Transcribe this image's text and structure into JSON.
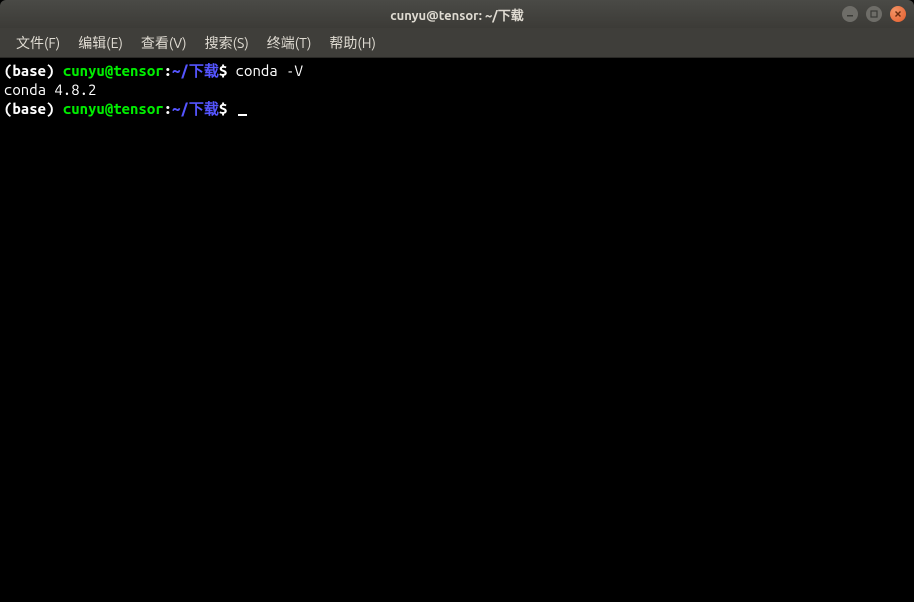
{
  "window": {
    "title": "cunyu@tensor: ~/下载"
  },
  "menu": {
    "items": [
      "文件(F)",
      "编辑(E)",
      "查看(V)",
      "搜索(S)",
      "终端(T)",
      "帮助(H)"
    ]
  },
  "terminal": {
    "lines": [
      {
        "env": "(base) ",
        "user": "cunyu@tensor",
        "colon": ":",
        "path": "~/下载",
        "dollar": "$ ",
        "command": "conda -V"
      },
      {
        "output": "conda 4.8.2"
      },
      {
        "env": "(base) ",
        "user": "cunyu@tensor",
        "colon": ":",
        "path": "~/下载",
        "dollar": "$ ",
        "command": "",
        "cursor": true
      }
    ]
  }
}
